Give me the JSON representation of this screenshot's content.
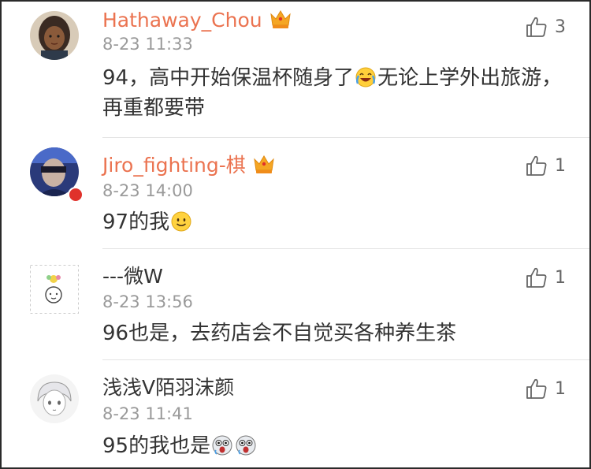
{
  "comments": [
    {
      "username": "Hathaway_Chou",
      "vip": true,
      "time": "8-23 11:33",
      "text_parts": [
        "94，高中开始保温杯随身了",
        "无论上学外出旅游，再重都要带"
      ],
      "likes": "3",
      "avatar_icon": "avatar-girl-icon",
      "emoji": "laughing-crying-emoji-icon"
    },
    {
      "username": "Jiro_fighting-棋",
      "vip": true,
      "time": "8-23 14:00",
      "text_parts": [
        "97的我"
      ],
      "likes": "1",
      "avatar_icon": "avatar-man-blue-icon",
      "emoji": "smile-emoji-icon"
    },
    {
      "username": "---微W",
      "vip": false,
      "time": "8-23 13:56",
      "text_parts": [
        "96也是，去药店会不自觉买各种养生茶"
      ],
      "likes": "1",
      "avatar_icon": "avatar-doodle-icon"
    },
    {
      "username": "浅浅V陌羽沫颜",
      "vip": false,
      "time": "8-23 11:41",
      "text_parts": [
        "95的我也是"
      ],
      "likes": "1",
      "avatar_icon": "avatar-anime-icon",
      "emoji": "frightened-emoji-icon"
    }
  ],
  "colors": {
    "vip_name": "#eb7350",
    "plain_name": "#333333",
    "time": "#9a9a9a",
    "divider": "#e3e3e3"
  }
}
